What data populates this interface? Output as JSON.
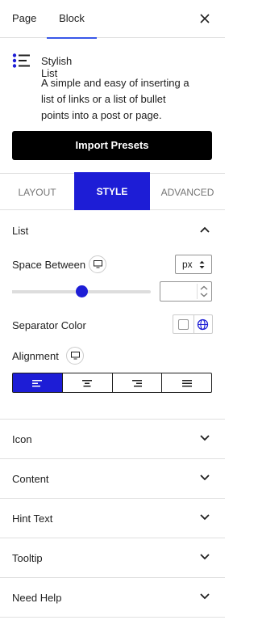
{
  "header": {
    "tabs": [
      {
        "label": "Page"
      },
      {
        "label": "Block"
      }
    ]
  },
  "block": {
    "title": "Stylish List",
    "description": "A simple and easy of inserting a list of links or a list of bullet points into a post or page.",
    "import_button": "Import Presets"
  },
  "style_tabs": [
    {
      "label": "LAYOUT"
    },
    {
      "label": "STYLE"
    },
    {
      "label": "ADVANCED"
    }
  ],
  "list_panel": {
    "title": "List",
    "space_between_label": "Space Between",
    "unit": "px",
    "slider_level": 0.5,
    "space_value": "",
    "separator_color_label": "Separator Color",
    "alignment_label": "Alignment"
  },
  "panels": [
    {
      "title": "Icon"
    },
    {
      "title": "Content"
    },
    {
      "title": "Hint Text"
    },
    {
      "title": "Tooltip"
    },
    {
      "title": "Need Help"
    }
  ],
  "colors": {
    "accent": "#1d1dd6",
    "wp_blue": "#3858e9"
  }
}
